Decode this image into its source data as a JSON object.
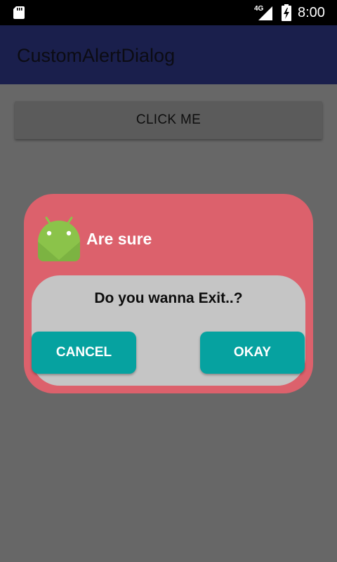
{
  "status_bar": {
    "network": "4G",
    "time": "8:00",
    "icons": [
      "sd-card-icon",
      "signal-icon",
      "battery-icon"
    ]
  },
  "app_bar": {
    "title": "CustomAlertDialog"
  },
  "main": {
    "button_label": "CLICK ME"
  },
  "dialog": {
    "icon": "android-icon",
    "title": "Are sure",
    "message": "Do you wanna Exit..?",
    "cancel_label": "CANCEL",
    "okay_label": "OKAY"
  },
  "colors": {
    "status_bar": "#000000",
    "app_bar": "#1a1f4c",
    "scrim_background": "#676767",
    "dialog_background": "#dc616c",
    "dialog_body": "#c5c5c5",
    "button_accent": "#06a2a0",
    "android_green": "#8bc34a"
  }
}
